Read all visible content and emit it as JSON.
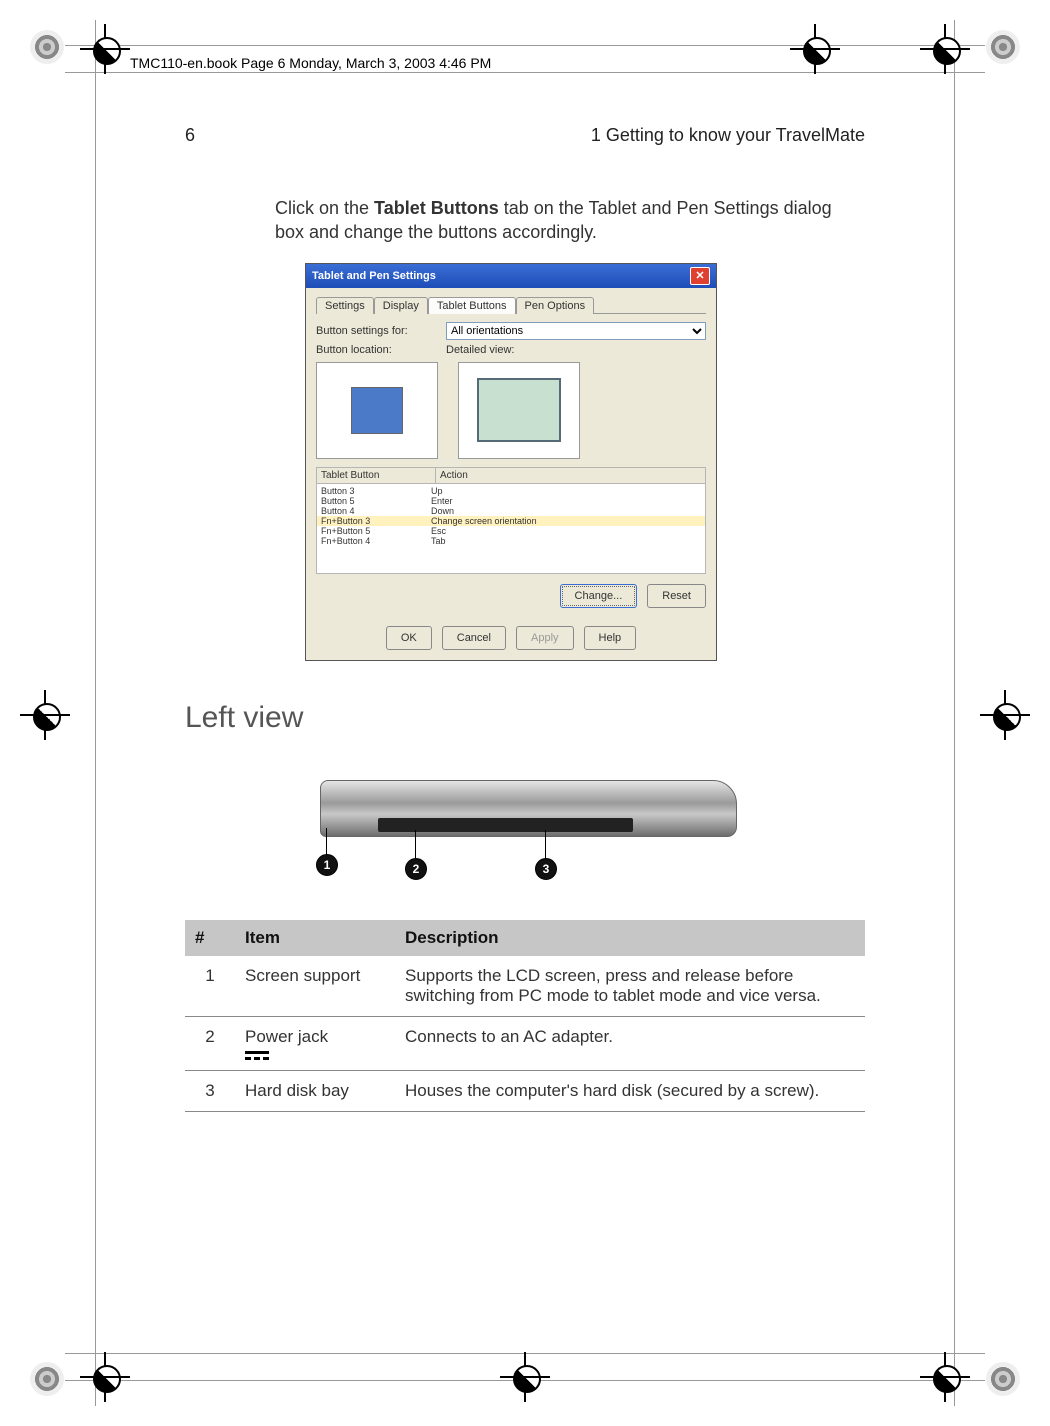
{
  "book_header": "TMC110-en.book  Page 6  Monday, March 3, 2003  4:46 PM",
  "page_number": "6",
  "chapter_title": "1 Getting to know your TravelMate",
  "intro": {
    "pre": "Click on the ",
    "bold": "Tablet Buttons",
    "post": " tab on the Tablet and Pen Settings dialog box and change the buttons accordingly."
  },
  "dialog": {
    "title": "Tablet and Pen Settings",
    "tabs": [
      "Settings",
      "Display",
      "Tablet Buttons",
      "Pen Options"
    ],
    "active_tab": 2,
    "settings_for_label": "Button settings for:",
    "settings_for_value": "All orientations",
    "location_label": "Button location:",
    "detailed_label": "Detailed view:",
    "list_headers": [
      "Tablet Button",
      "Action"
    ],
    "rows": [
      {
        "b": "Button 3",
        "a": "Up"
      },
      {
        "b": "Button 5",
        "a": "Enter"
      },
      {
        "b": "Button 4",
        "a": "Down"
      },
      {
        "b": "Fn+Button 3",
        "a": "Change screen orientation"
      },
      {
        "b": "Fn+Button 5",
        "a": "Esc"
      },
      {
        "b": "Fn+Button 4",
        "a": "Tab"
      }
    ],
    "change_btn": "Change...",
    "reset_btn": "Reset",
    "ok_btn": "OK",
    "cancel_btn": "Cancel",
    "apply_btn": "Apply",
    "help_btn": "Help"
  },
  "section_heading": "Left view",
  "callouts": [
    "1",
    "2",
    "3"
  ],
  "table": {
    "headers": [
      "#",
      "Item",
      "Description"
    ],
    "rows": [
      {
        "n": "1",
        "item": "Screen support",
        "desc": "Supports the LCD screen, press and release before switching from PC mode to tablet mode and vice versa."
      },
      {
        "n": "2",
        "item": "Power jack",
        "desc": "Connects to an AC adapter.",
        "has_power_icon": true
      },
      {
        "n": "3",
        "item": "Hard disk bay",
        "desc": "Houses the computer's hard disk (secured by a screw)."
      }
    ]
  }
}
